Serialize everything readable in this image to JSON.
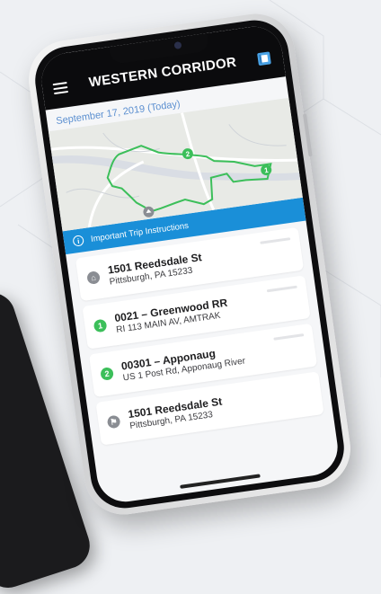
{
  "app": {
    "title": "WESTERN CORRIDOR",
    "date": "September 17, 2019 (Today)"
  },
  "banner": {
    "label": "Important Trip Instructions"
  },
  "map": {
    "route_color": "#3cbf5a",
    "markers": [
      "2",
      "1"
    ]
  },
  "stops": [
    {
      "badge": "",
      "badge_icon": "home-icon",
      "line1": "1501 Reedsdale St",
      "line2": "Pittsburgh, PA 15233"
    },
    {
      "badge": "1",
      "line1": "0021 – Greenwood RR",
      "line2": "RI 113 MAIN AV, AMTRAK"
    },
    {
      "badge": "2",
      "line1": "00301 – Apponaug",
      "line2": "US 1 Post Rd, Apponaug River"
    },
    {
      "badge": "",
      "badge_icon": "flag-icon",
      "line1": "1501 Reedsdale St",
      "line2": "Pittsburgh, PA 15233"
    }
  ],
  "colors": {
    "accent_blue": "#1a8fd8",
    "green": "#3cbf5a",
    "date_blue": "#5b8fd0"
  }
}
